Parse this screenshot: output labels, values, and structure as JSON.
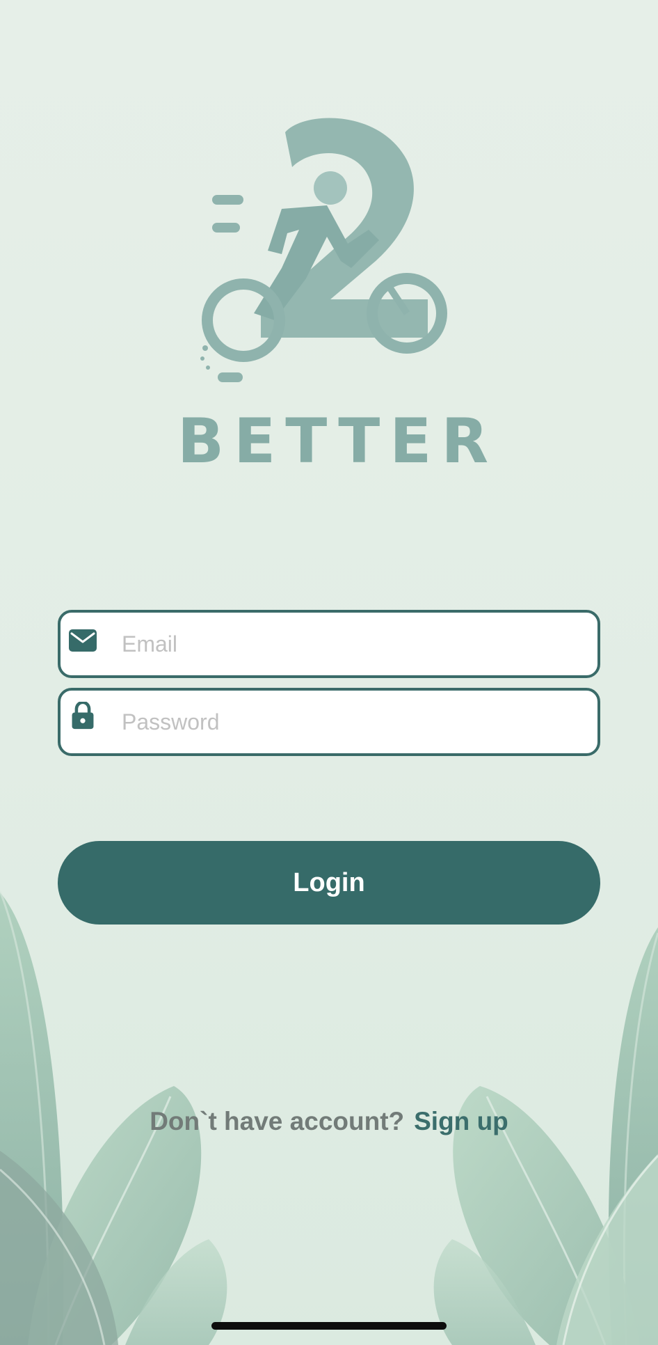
{
  "brand": {
    "name": "BETTER",
    "logo_color": "#8fb3ad"
  },
  "form": {
    "email": {
      "placeholder": "Email",
      "value": "",
      "icon": "mail-icon"
    },
    "password": {
      "placeholder": "Password",
      "value": "",
      "icon": "lock-icon"
    }
  },
  "login_button": {
    "label": "Login"
  },
  "signup": {
    "prompt": "Don`t have account?",
    "link_label": "Sign up"
  },
  "colors": {
    "accent": "#366b69",
    "field_border": "#3a6b69",
    "background": "#e3eee6",
    "prompt_text": "#727b78",
    "leaf": "#8fbba6"
  }
}
